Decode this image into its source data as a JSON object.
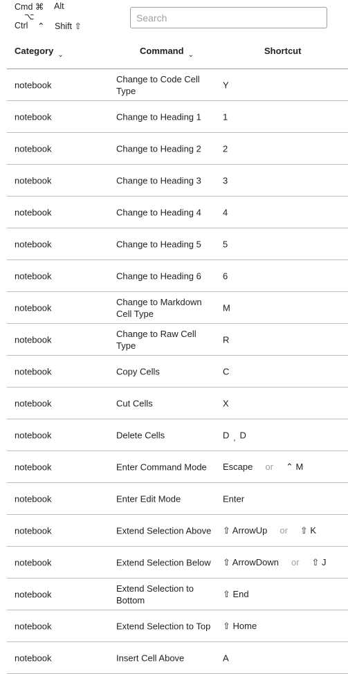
{
  "legend": {
    "cmd": "Cmd ⌘",
    "alt": "Alt",
    "alt_symbol": "⌥",
    "ctrl": "Ctrl",
    "ctrl_symbol": "⌃",
    "shift": "Shift ⇧"
  },
  "search": {
    "placeholder": "Search",
    "value": ""
  },
  "header": {
    "category": "Category",
    "command": "Command",
    "shortcut": "Shortcut",
    "sort_icon": "⌄"
  },
  "rows": [
    {
      "category": "notebook",
      "command": "Change to Code Cell Type",
      "shortcut": [
        [
          "Y"
        ]
      ]
    },
    {
      "category": "notebook",
      "command": "Change to Heading 1",
      "shortcut": [
        [
          "1"
        ]
      ]
    },
    {
      "category": "notebook",
      "command": "Change to Heading 2",
      "shortcut": [
        [
          "2"
        ]
      ]
    },
    {
      "category": "notebook",
      "command": "Change to Heading 3",
      "shortcut": [
        [
          "3"
        ]
      ]
    },
    {
      "category": "notebook",
      "command": "Change to Heading 4",
      "shortcut": [
        [
          "4"
        ]
      ]
    },
    {
      "category": "notebook",
      "command": "Change to Heading 5",
      "shortcut": [
        [
          "5"
        ]
      ]
    },
    {
      "category": "notebook",
      "command": "Change to Heading 6",
      "shortcut": [
        [
          "6"
        ]
      ]
    },
    {
      "category": "notebook",
      "command": "Change to Markdown Cell Type",
      "shortcut": [
        [
          "M"
        ]
      ]
    },
    {
      "category": "notebook",
      "command": "Change to Raw Cell Type",
      "shortcut": [
        [
          "R"
        ]
      ]
    },
    {
      "category": "notebook",
      "command": "Copy Cells",
      "shortcut": [
        [
          "C"
        ]
      ]
    },
    {
      "category": "notebook",
      "command": "Cut Cells",
      "shortcut": [
        [
          "X"
        ]
      ]
    },
    {
      "category": "notebook",
      "command": "Delete Cells",
      "shortcut": [
        [
          "D",
          "D"
        ]
      ]
    },
    {
      "category": "notebook",
      "command": "Enter Command Mode",
      "shortcut": [
        [
          "Escape"
        ],
        [
          "⌃ M"
        ]
      ]
    },
    {
      "category": "notebook",
      "command": "Enter Edit Mode",
      "shortcut": [
        [
          "Enter"
        ]
      ]
    },
    {
      "category": "notebook",
      "command": "Extend Selection Above",
      "shortcut": [
        [
          "⇧ ArrowUp"
        ],
        [
          "⇧ K"
        ]
      ]
    },
    {
      "category": "notebook",
      "command": "Extend Selection Below",
      "shortcut": [
        [
          "⇧ ArrowDown"
        ],
        [
          "⇧ J"
        ]
      ]
    },
    {
      "category": "notebook",
      "command": "Extend Selection to Bottom",
      "shortcut": [
        [
          "⇧ End"
        ]
      ]
    },
    {
      "category": "notebook",
      "command": "Extend Selection to Top",
      "shortcut": [
        [
          "⇧ Home"
        ]
      ]
    },
    {
      "category": "notebook",
      "command": "Insert Cell Above",
      "shortcut": [
        [
          "A"
        ]
      ]
    }
  ],
  "or_label": "or",
  "seq_separator": ","
}
